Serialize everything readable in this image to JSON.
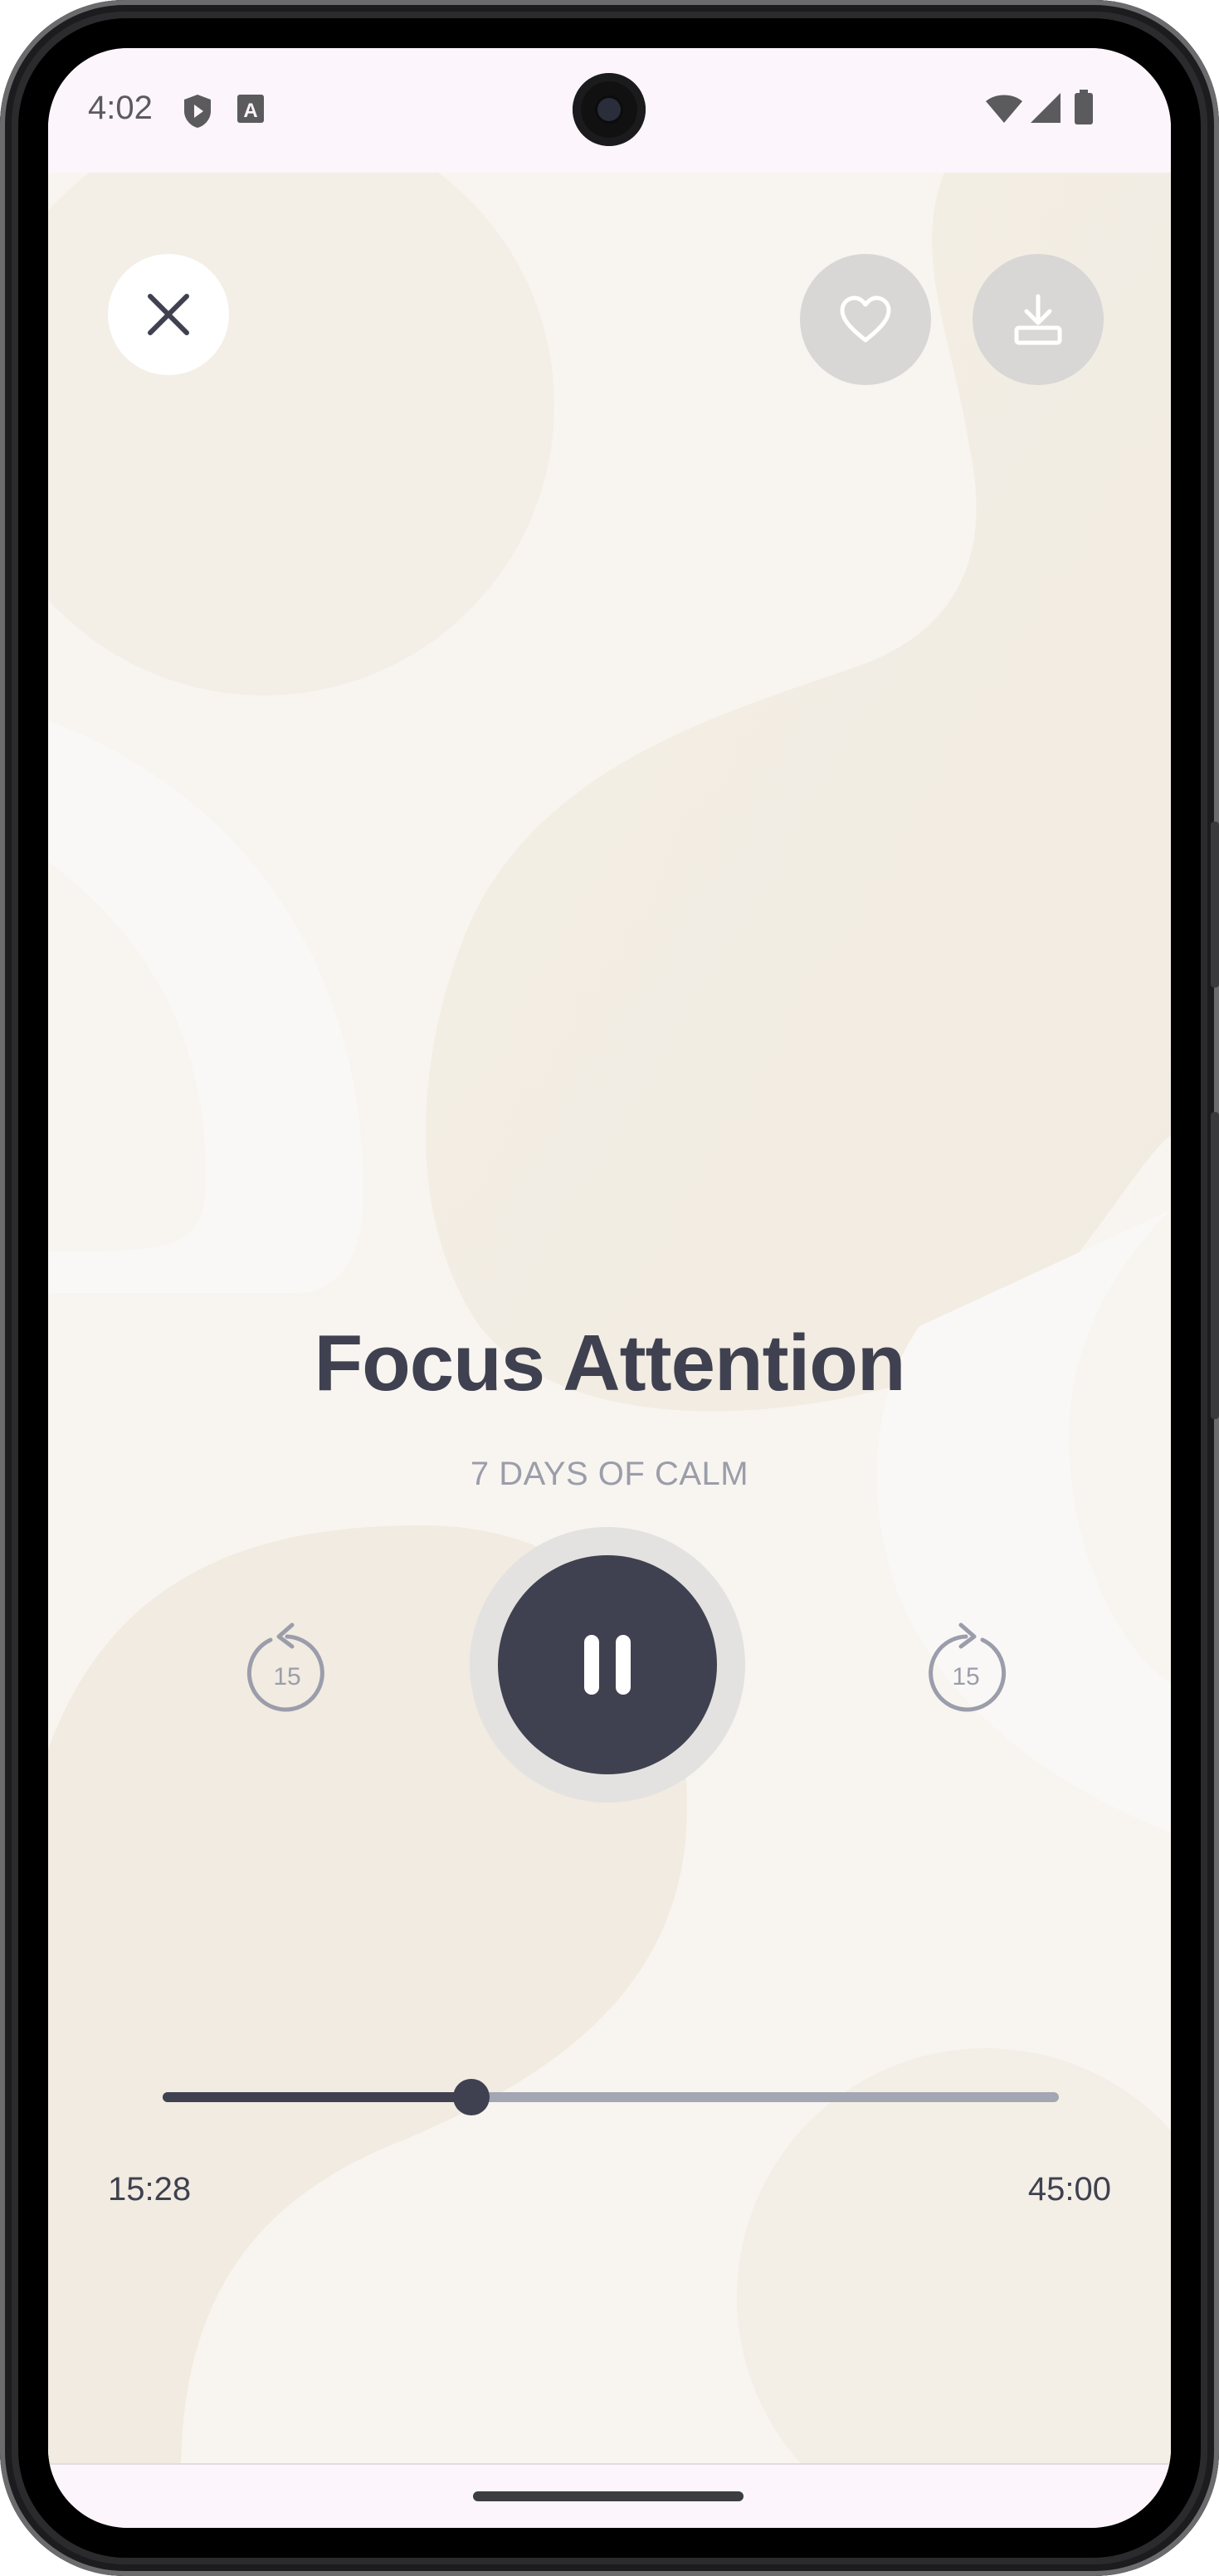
{
  "status_bar": {
    "time": "4:02"
  },
  "player": {
    "title": "Focus Attention",
    "subtitle": "7 DAYS OF CALM",
    "skip_back_seconds": "15",
    "skip_forward_seconds": "15",
    "elapsed": "15:28",
    "duration": "45:00",
    "progress_fraction": 0.344,
    "state": "playing"
  },
  "colors": {
    "background": "#f8f5f0",
    "accent": "#3f4150",
    "track": "#a3a6b3",
    "secondary_text": "#9b9daa"
  },
  "icons": {
    "close": "close-icon",
    "favorite": "heart-icon",
    "download": "download-icon",
    "pause": "pause-icon",
    "rewind": "rewind-15-icon",
    "forward": "forward-15-icon"
  }
}
